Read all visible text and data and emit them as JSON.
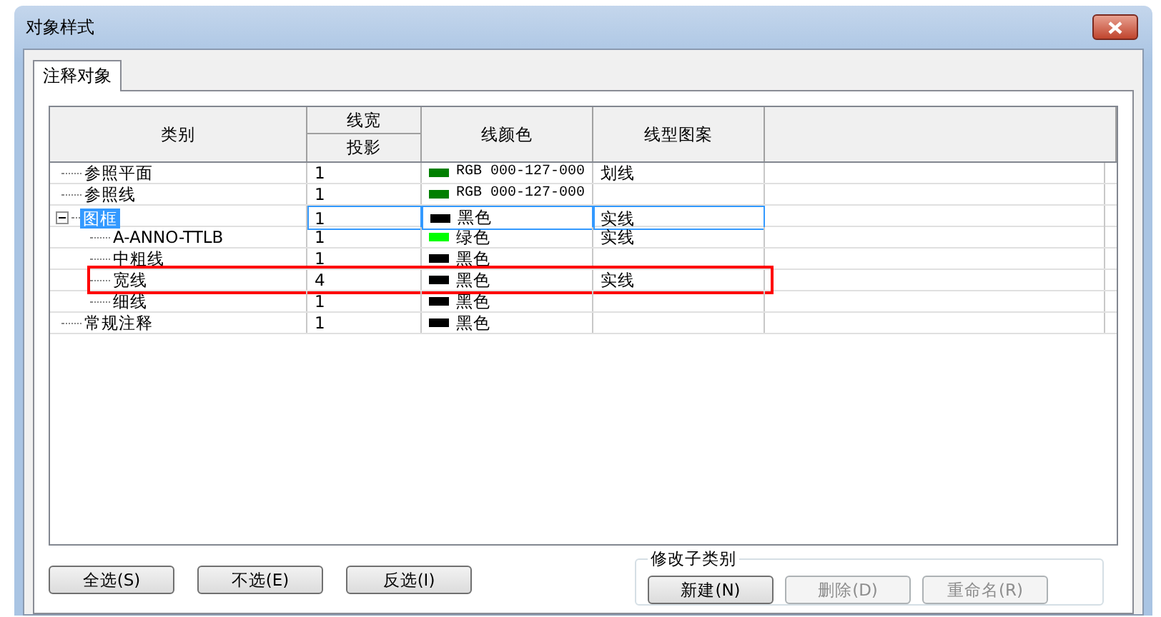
{
  "window": {
    "title": "对象样式"
  },
  "tabs": [
    {
      "label": "注释对象",
      "selected": true
    }
  ],
  "table": {
    "columns": {
      "category": "类别",
      "line_weight": "线宽",
      "projection": "投影",
      "line_color": "线颜色",
      "line_pattern": "线型图案"
    },
    "rows": [
      {
        "name": "参照平面",
        "weight": "1",
        "color": "#007f00",
        "color_label": "RGB 000-127-000",
        "pattern": "划线",
        "selected": false,
        "highlighted": false
      },
      {
        "name": "参照线",
        "weight": "1",
        "color": "#007f00",
        "color_label": "RGB 000-127-000",
        "selected": false,
        "highlighted": false
      },
      {
        "name": "图框",
        "weight": "1",
        "color": "#000000",
        "color_label": "黑色",
        "pattern": "实线",
        "selected": true,
        "highlighted": false,
        "expanded": true,
        "children": [
          {
            "name": "A-ANNO-TTLB",
            "weight": "1",
            "color": "#00ff00",
            "color_label": "绿色",
            "pattern": "实线",
            "selected": false,
            "highlighted": false
          },
          {
            "name": "中粗线",
            "weight": "1",
            "color": "#000000",
            "color_label": "黑色",
            "selected": false,
            "highlighted": false
          },
          {
            "name": "宽线",
            "weight": "4",
            "color": "#000000",
            "color_label": "黑色",
            "pattern": "实线",
            "selected": false,
            "highlighted": true
          },
          {
            "name": "细线",
            "weight": "1",
            "color": "#000000",
            "color_label": "黑色",
            "selected": false,
            "highlighted": false
          }
        ]
      },
      {
        "name": "常规注释",
        "weight": "1",
        "color": "#000000",
        "color_label": "黑色",
        "selected": false,
        "highlighted": false
      }
    ]
  },
  "selection_buttons": [
    "全选(S)",
    "不选(E)",
    "反选(I)"
  ],
  "subcategory_group": {
    "title": "修改子类别",
    "buttons": [
      {
        "label": "新建(N)",
        "disabled": false
      },
      {
        "label": "删除(D)",
        "disabled": true
      },
      {
        "label": "重命名(R)",
        "disabled": true
      }
    ]
  }
}
